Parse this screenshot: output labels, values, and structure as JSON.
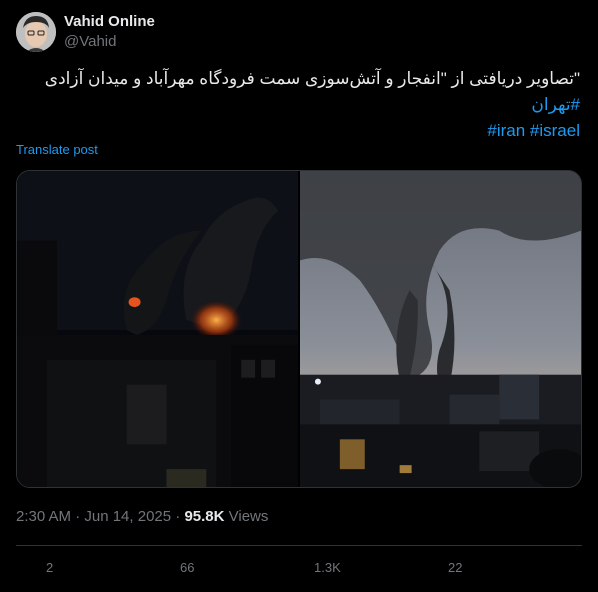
{
  "author": {
    "name": "Vahid Online",
    "handle": "@Vahid"
  },
  "tweet": {
    "text_prefix": "\"تصاویر دریافتی از \"انفجار و آتش‌سوزی سمت فرودگاه مهرآباد و میدان آزادی ",
    "hashtag_city": "#تهران",
    "hashtag_israel": "#israel",
    "hashtag_iran": "#iran"
  },
  "translate_label": "Translate post",
  "meta": {
    "time": "2:30 AM · Jun 14, 2025 · ",
    "views_count": "95.8K",
    "views_label": " Views"
  },
  "actions": {
    "replies": "2",
    "reposts": "66",
    "likes": "1.3K",
    "bookmarks": "22"
  },
  "colors": {
    "link": "#1d9bf0",
    "muted": "#71767b",
    "text": "#e7e9ea"
  }
}
